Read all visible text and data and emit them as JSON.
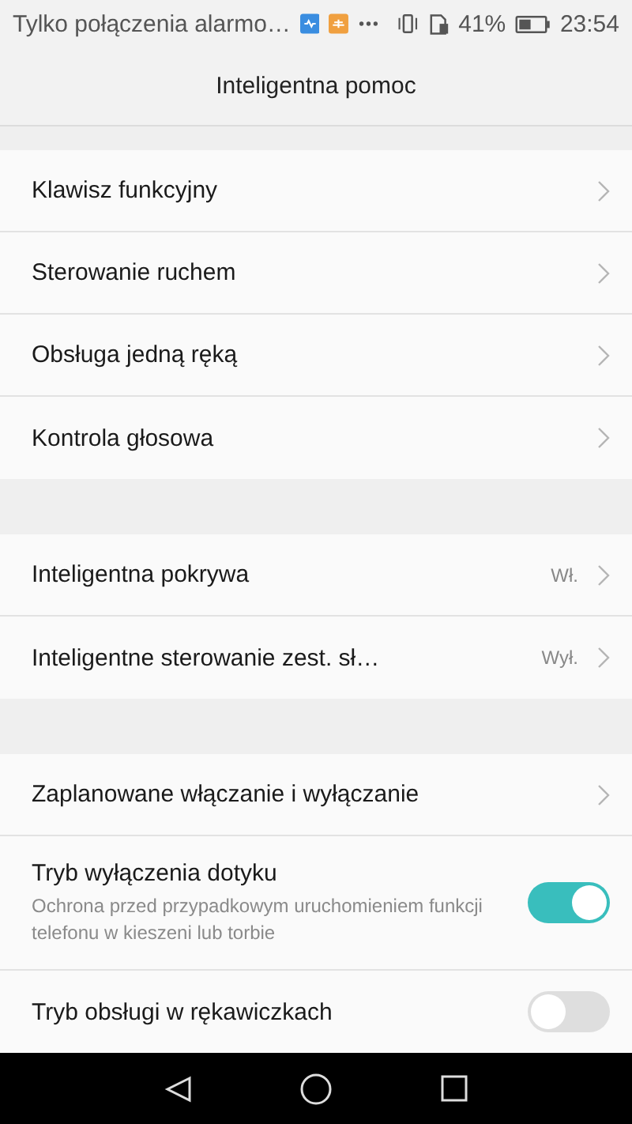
{
  "status_bar": {
    "notification_text": "Tylko połączenia alarmo…",
    "battery_percent": "41%",
    "time": "23:54"
  },
  "header": {
    "title": "Inteligentna pomoc"
  },
  "sections": [
    {
      "items": [
        {
          "kind": "link",
          "label": "Klawisz funkcyjny"
        },
        {
          "kind": "link",
          "label": "Sterowanie ruchem"
        },
        {
          "kind": "link",
          "label": "Obsługa jedną ręką"
        },
        {
          "kind": "link",
          "label": "Kontrola głosowa"
        }
      ]
    },
    {
      "items": [
        {
          "kind": "link",
          "label": "Inteligentna pokrywa",
          "value": "Wł."
        },
        {
          "kind": "link",
          "label": "Inteligentne sterowanie zest. sł…",
          "value": "Wył."
        }
      ]
    },
    {
      "items": [
        {
          "kind": "link",
          "label": "Zaplanowane włączanie i wyłączanie"
        },
        {
          "kind": "toggle",
          "label": "Tryb wyłączenia dotyku",
          "description": "Ochrona przed przypadkowym uruchomieniem funkcji telefonu w kieszeni lub torbie",
          "on": true
        },
        {
          "kind": "toggle",
          "label": "Tryb obsługi w rękawiczkach",
          "on": false
        }
      ]
    }
  ]
}
